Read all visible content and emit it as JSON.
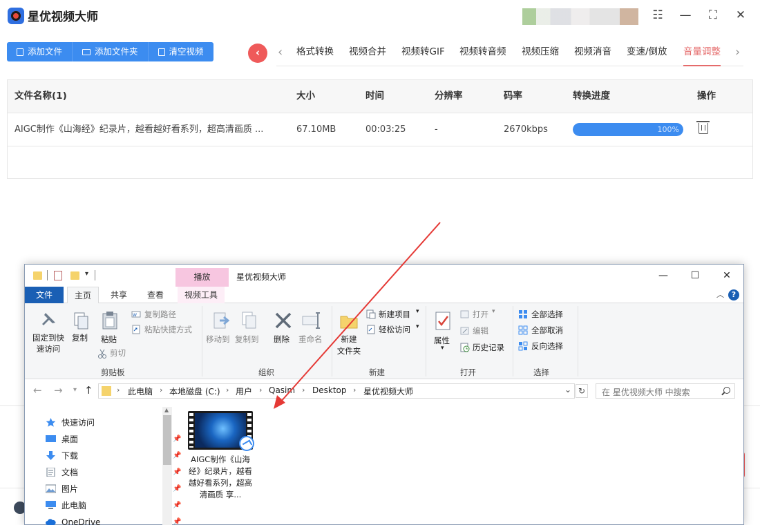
{
  "app": {
    "title": "星优视频大师",
    "window_controls": {
      "settings": "☷",
      "minimize": "—",
      "maximize": "⛶",
      "close": "✕"
    }
  },
  "toolbar": {
    "buttons": [
      {
        "label": "添加文件",
        "icon": "file-icon"
      },
      {
        "label": "添加文件夹",
        "icon": "folder-icon"
      },
      {
        "label": "清空视频",
        "icon": "trash-icon"
      }
    ]
  },
  "tabs": {
    "back": "‹",
    "prev": "‹",
    "next": "›",
    "items": [
      "格式转换",
      "视频合并",
      "视频转GIF",
      "视频转音频",
      "视频压缩",
      "视频消音",
      "变速/倒放",
      "音量调整"
    ],
    "active": "音量调整"
  },
  "table": {
    "headers": [
      "文件名称(1)",
      "大小",
      "时间",
      "分辨率",
      "码率",
      "转换进度",
      "操作"
    ],
    "rows": [
      {
        "name": "AIGC制作《山海经》纪录片，越看越好看系列，超高清画质 ...",
        "size": "67.10MB",
        "time": "00:03:25",
        "resolution": "-",
        "bitrate": "2670kbps",
        "progress": 100,
        "progress_text": "100%"
      }
    ]
  },
  "explorer": {
    "context_tab_header": "播放",
    "title": "星优视频大师",
    "ribbon_tabs": [
      "文件",
      "主页",
      "共享",
      "查看",
      "视频工具"
    ],
    "groups": {
      "clipboard": {
        "label": "剪贴板",
        "pin": "固定到快\n速访问",
        "copy": "复制",
        "paste": "粘贴",
        "copy_path": "复制路径",
        "paste_shortcut": "粘贴快捷方式",
        "cut": "剪切"
      },
      "organize": {
        "label": "组织",
        "move_to": "移动到",
        "copy_to": "复制到",
        "delete": "删除",
        "rename": "重命名"
      },
      "new": {
        "label": "新建",
        "new_folder": "新建\n文件夹",
        "new_item": "新建项目",
        "easy_access": "轻松访问"
      },
      "open": {
        "label": "打开",
        "properties": "属性",
        "open": "打开",
        "edit": "编辑",
        "history": "历史记录"
      },
      "select": {
        "label": "选择",
        "select_all": "全部选择",
        "select_none": "全部取消",
        "invert": "反向选择"
      }
    },
    "address": [
      "此电脑",
      "本地磁盘 (C:)",
      "用户",
      "Qasim",
      "Desktop",
      "星优视频大师"
    ],
    "search_placeholder": "在 星优视频大师 中搜索",
    "nav": [
      {
        "label": "快速访问",
        "icon": "star-icon"
      },
      {
        "label": "桌面",
        "icon": "desktop-icon"
      },
      {
        "label": "下载",
        "icon": "download-icon"
      },
      {
        "label": "文档",
        "icon": "document-icon"
      },
      {
        "label": "图片",
        "icon": "picture-icon"
      },
      {
        "label": "此电脑",
        "icon": "computer-icon"
      },
      {
        "label": "OneDrive",
        "icon": "cloud-icon"
      }
    ],
    "file": {
      "name": "AIGC制作《山海经》纪录片，越看越好看系列，超高清画质 享..."
    }
  },
  "colors": {
    "accent_blue": "#3c8cf0",
    "active_tab": "#e56b6b",
    "back_button": "#ef5a5a",
    "annotation_arrow": "#e53935"
  }
}
